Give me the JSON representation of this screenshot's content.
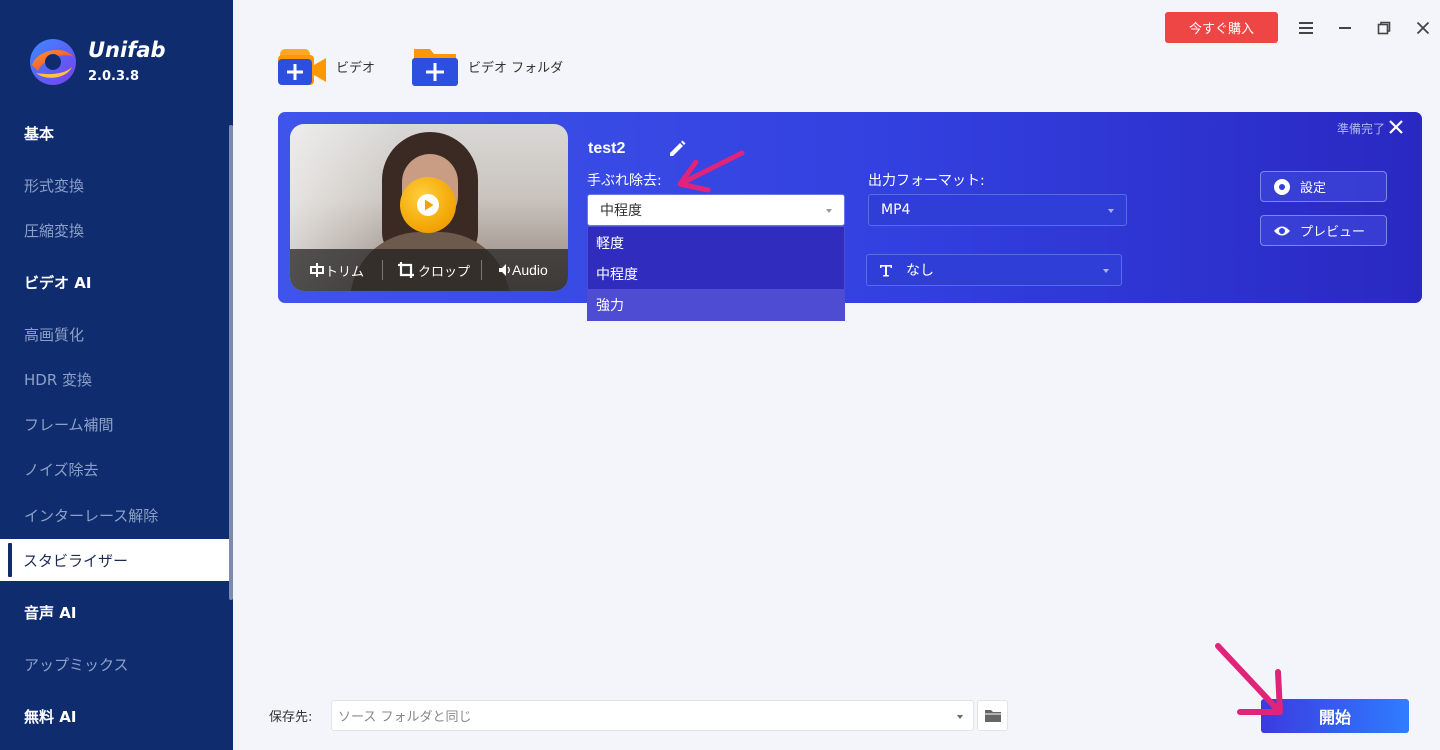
{
  "app": {
    "name": "Unifab",
    "version": "2.0.3.8"
  },
  "sidebar": {
    "items": [
      {
        "label": "基本",
        "type": "section"
      },
      {
        "label": "形式変換",
        "type": "item"
      },
      {
        "label": "圧縮変換",
        "type": "item"
      },
      {
        "label": "ビデオ AI",
        "type": "section"
      },
      {
        "label": "高画質化",
        "type": "item"
      },
      {
        "label": "HDR 変換",
        "type": "item"
      },
      {
        "label": "フレーム補間",
        "type": "item"
      },
      {
        "label": "ノイズ除去",
        "type": "item"
      },
      {
        "label": "インターレース解除",
        "type": "item"
      },
      {
        "label": "スタビライザー",
        "type": "item",
        "active": true
      },
      {
        "label": "音声 AI",
        "type": "section"
      },
      {
        "label": "アップミックス",
        "type": "item"
      },
      {
        "label": "無料 AI",
        "type": "section"
      }
    ]
  },
  "window": {
    "buy_label": "今すぐ購入",
    "menu_icon": "hamburger-icon",
    "minimize_icon": "minimize-icon",
    "restore_icon": "restore-icon",
    "close_icon": "close-icon"
  },
  "toolbar": {
    "add_video_label": "ビデオ",
    "add_folder_label": "ビデオ フォルダ"
  },
  "task": {
    "file_name": "test2",
    "status": "準備完了",
    "thumb_tools": {
      "trim_label": "トリム",
      "crop_label": "クロップ",
      "audio_label": "Audio"
    },
    "shake_label": "手ぶれ除去:",
    "shake_selected": "中程度",
    "shake_options": [
      "軽度",
      "中程度",
      "強力"
    ],
    "shake_hover_index": 2,
    "format_label": "出力フォーマット:",
    "format_value": "MP4",
    "subtitle_value": "なし",
    "settings_label": "設定",
    "preview_label": "プレビュー"
  },
  "footer": {
    "save_label": "保存先:",
    "save_path_value": "ソース フォルダと同じ",
    "start_label": "開始"
  },
  "colors": {
    "sidebar_bg": "#0f2d6e",
    "card_bg": "#3240df",
    "buy_button": "#ee4545",
    "annotation_arrow": "#e0247a"
  }
}
